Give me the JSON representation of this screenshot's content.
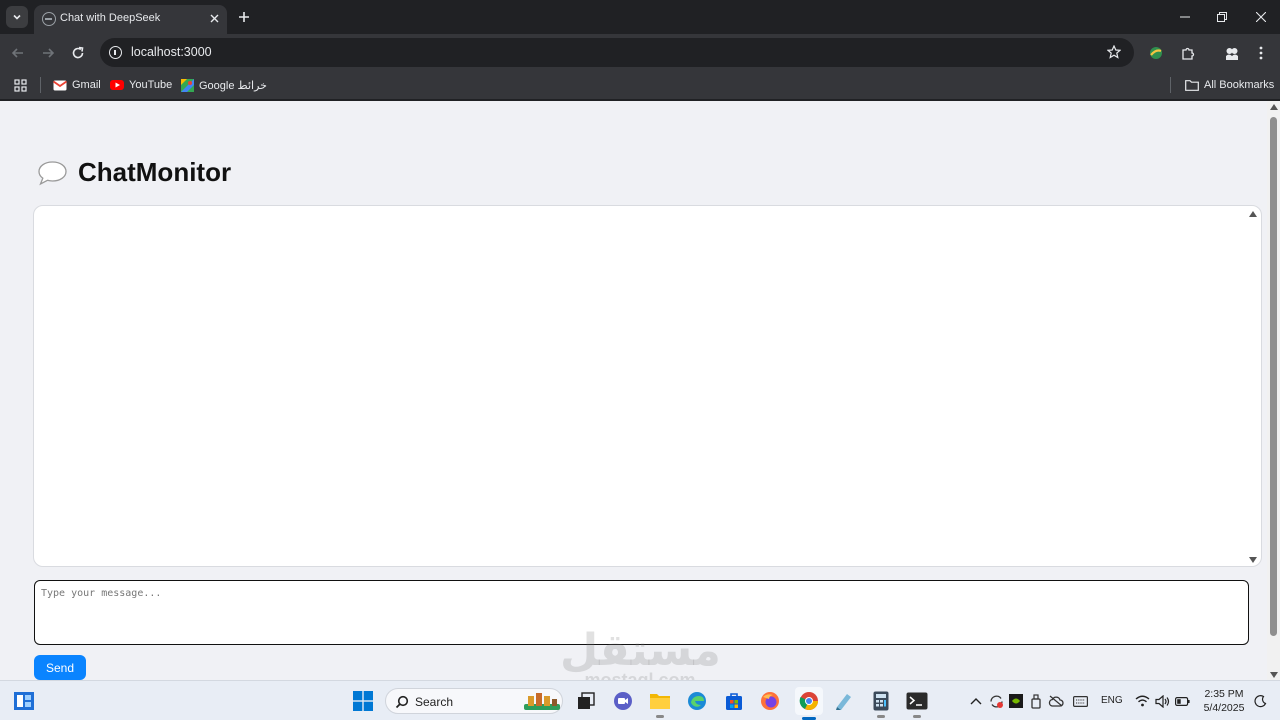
{
  "browser": {
    "tab": {
      "title": "Chat with DeepSeek"
    },
    "omnibox": {
      "url": "localhost:3000"
    },
    "bookmarks": [
      {
        "label": "Gmail",
        "icon": "gmail-icon"
      },
      {
        "label": "YouTube",
        "icon": "youtube-icon"
      },
      {
        "label": "Google خرائط",
        "icon": "google-maps-icon"
      }
    ],
    "all_bookmarks_label": "All Bookmarks"
  },
  "app": {
    "title": "ChatMonitor",
    "title_icon": "speech-bubble-icon",
    "message_placeholder": "Type your message...",
    "send_label": "Send"
  },
  "watermark": {
    "arabic": "مستقل",
    "latin": "mostaql.com"
  },
  "taskbar": {
    "search_placeholder": "Search",
    "language": "ENG",
    "time": "2:35 PM",
    "date": "5/4/2025"
  },
  "colors": {
    "accent": "#0a84ff",
    "page_background": "#f0f1f5",
    "browser_chrome": "#35363a",
    "taskbar": "#e8edf5"
  }
}
